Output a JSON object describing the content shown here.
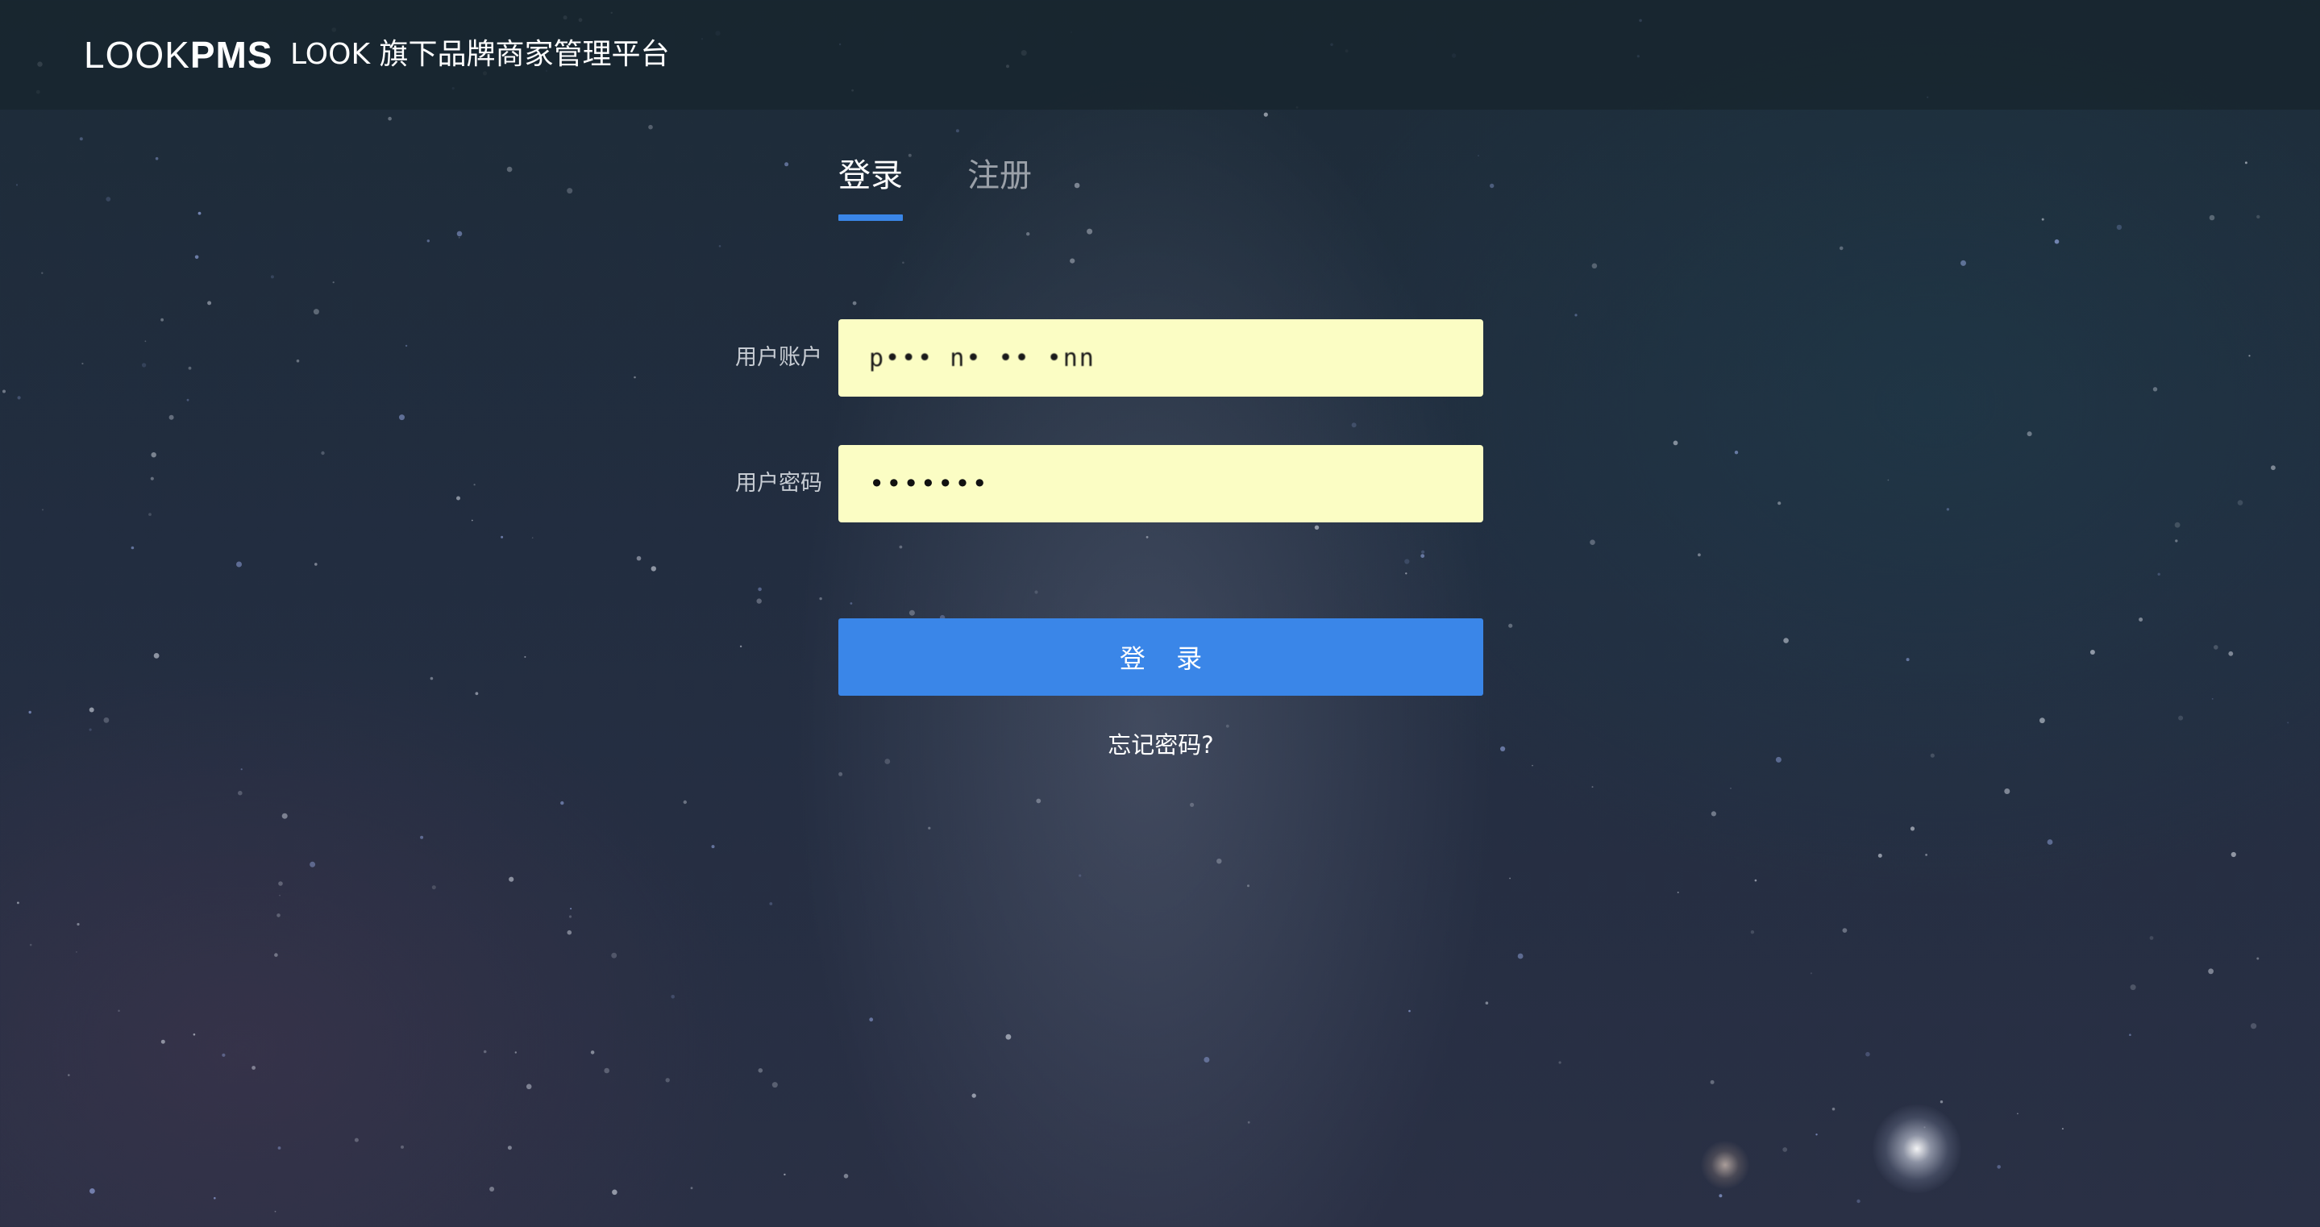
{
  "header": {
    "logo_light": "LOOK",
    "logo_bold": "PMS",
    "platform_title": "LOOK 旗下品牌商家管理平台"
  },
  "tabs": [
    {
      "label": "登录",
      "active": true
    },
    {
      "label": "注册",
      "active": false
    }
  ],
  "form": {
    "account_label": "用户账户",
    "account_value": "p••• n• •• •nn",
    "password_label": "用户密码",
    "password_value": "•••••••",
    "submit_label": "登 录",
    "forgot_label": "忘记密码?"
  },
  "colors": {
    "accent": "#3a86e8",
    "input_background": "#fbfdc4",
    "header_background": "#16242c"
  }
}
